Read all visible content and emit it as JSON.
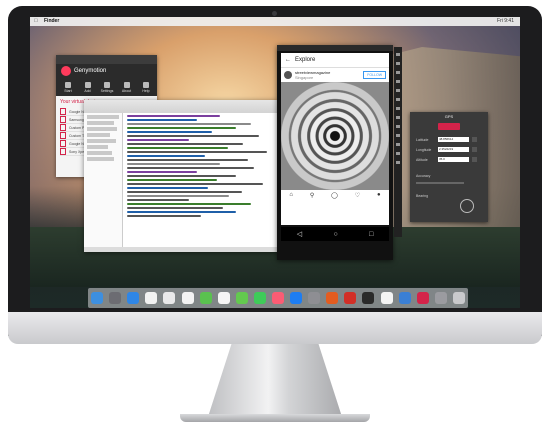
{
  "menubar": {
    "app_name": "Finder",
    "right_status": "Fri 9:41"
  },
  "genymotion": {
    "title": "Genymotion",
    "tools": [
      "Start",
      "Add",
      "Settings",
      "About",
      "Help"
    ],
    "section_title": "Your virtual devices",
    "devices": [
      "Google Nexus 5",
      "Samsung Galaxy S6",
      "Custom Phone",
      "Custom Tablet",
      "Google Nexus 9",
      "Sony Xperia Z"
    ]
  },
  "emulator": {
    "header": "Explore",
    "user": "streetviewmagazine",
    "location": "Singapore",
    "follow_label": "FOLLOW"
  },
  "gps": {
    "title": "GPS",
    "fields": [
      {
        "label": "Latitude",
        "value": "48.856614"
      },
      {
        "label": "Longitude",
        "value": "2.3522219"
      },
      {
        "label": "Altitude",
        "value": "35.0"
      }
    ],
    "accuracy_label": "Accuracy",
    "bearing_label": "Bearing"
  },
  "colors": {
    "brand": "#d4234a",
    "dock": "#d2d2d7"
  }
}
